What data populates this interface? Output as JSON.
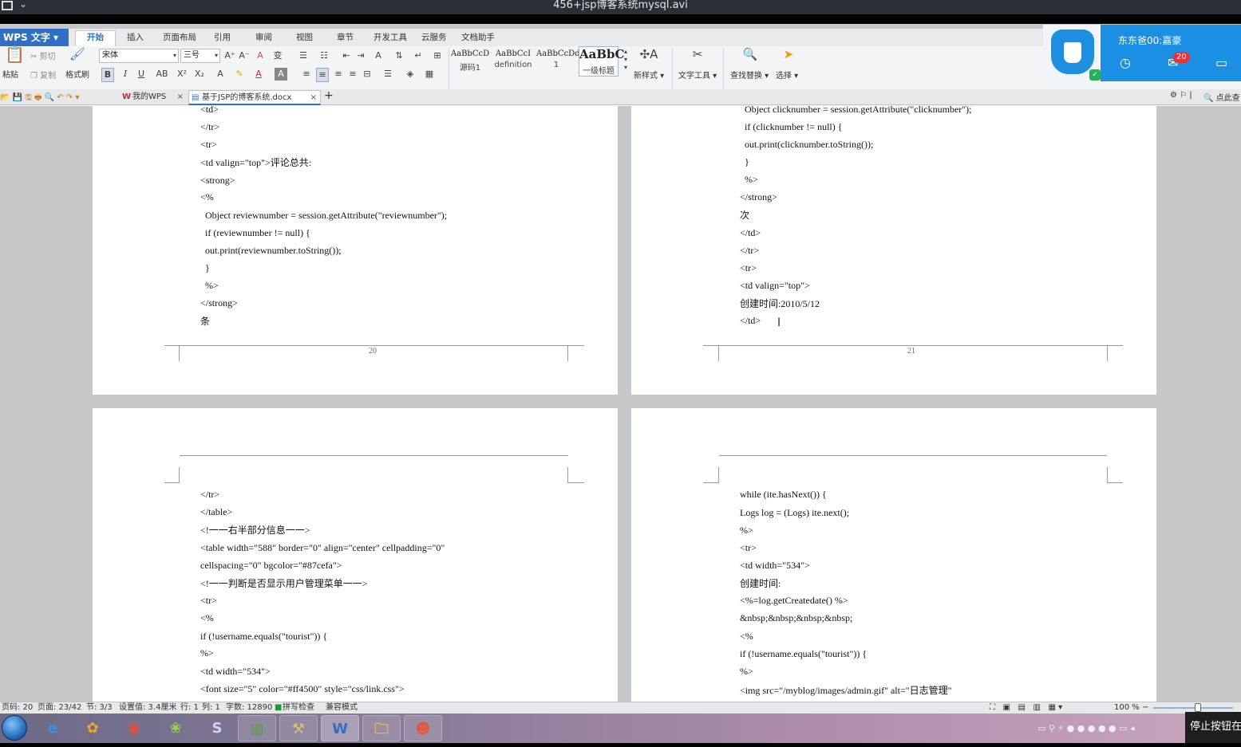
{
  "window": {
    "title": "456+jsp博客系统mysql.avi"
  },
  "menubar": {
    "app_button": "WPS 文字",
    "tabs": [
      "开始",
      "插入",
      "页面布局",
      "引用",
      "审阅",
      "视图",
      "章节",
      "开发工具",
      "云服务",
      "文档助手"
    ]
  },
  "ribbon": {
    "paste": "粘贴",
    "cut": "剪切",
    "copy": "复制",
    "format_painter": "格式刷",
    "font_name": "宋体",
    "font_size": "三号",
    "styles": [
      {
        "sample": "AaBbCcD",
        "name": "源码1"
      },
      {
        "sample": "AaBbCcI",
        "name": "definition"
      },
      {
        "sample": "AaBbCcDd",
        "name": "1"
      },
      {
        "sample": "AaBbC",
        "name": "一级标题"
      }
    ],
    "new_style": "新样式",
    "text_tools": "文字工具",
    "find_replace": "查找替换",
    "select": "选择"
  },
  "tabbar": {
    "home_tab": "我的WPS",
    "doc_tab": "基于JSP的博客系统.docx",
    "search_hint": "点此查"
  },
  "popup": {
    "username": "东东爸00:嘉豪",
    "badge": "20"
  },
  "pages": {
    "p20_top": {
      "lines": [
        "<td>",
        "</tr>",
        "<tr>",
        "<td valign=\"top\">评论总共:",
        "<strong>",
        "<%",
        "Object reviewnumber = session.getAttribute(\"reviewnumber\");",
        "if (reviewnumber != null) {",
        "out.print(reviewnumber.toString());",
        "}",
        "%>",
        "</strong>",
        "条"
      ],
      "page_number": "20"
    },
    "p21_top": {
      "lines": [
        "Object clicknumber = session.getAttribute(\"clicknumber\");",
        "if (clicknumber != null) {",
        "out.print(clicknumber.toString());",
        "}",
        "%>",
        "</strong>",
        "次",
        "</td>",
        "</tr>",
        "<tr>",
        "<td valign=\"top\">",
        "创建时间:2010/5/12",
        "</td>"
      ],
      "page_number": "21"
    },
    "p22_bottom": {
      "lines": [
        "</tr>",
        "</table>",
        "<!一一右半部分信息一一>",
        "<table width=\"588\" border=\"0\" align=\"center\" cellpadding=\"0\"",
        "cellspacing=\"0\" bgcolor=\"#87cefa\">",
        "<!一一判断是否显示用户管理菜单一一>",
        "<tr>",
        "<%",
        "if (!username.equals(\"tourist\")) {",
        "%>",
        "<td width=\"534\">",
        "<font size=\"5\" color=\"#ff4500\" style=\"css/link.css\">"
      ]
    },
    "p23_bottom": {
      "lines": [
        "while (ite.hasNext()) {",
        "Logs log = (Logs) ite.next();",
        "%>",
        "<tr>",
        "<td width=\"534\">",
        "创建时间:",
        "<%=log.getCreatedate() %>",
        "&nbsp;&nbsp;&nbsp;&nbsp;",
        "<%",
        "if (!username.equals(\"tourist\")) {",
        "%>",
        "<img src=\"/myblog/images/admin.gif\" alt=\"日志管理\""
      ]
    }
  },
  "statusbar": {
    "page_code": "页码: 20",
    "pages": "页面: 23/42",
    "section": "节: 3/3",
    "setting": "设置值: 3.4厘米",
    "row": "行: 1",
    "col": "列: 1",
    "wordcount": "字数: 12890",
    "spellcheck": "拼写检查",
    "compat": "兼容模式",
    "zoom": "100 %"
  },
  "taskbar": {
    "notification": "停止按钮在"
  },
  "colors": {
    "accent": "#2f6fc6",
    "popup": "#1a8fe3",
    "badge": "#e8333a"
  }
}
